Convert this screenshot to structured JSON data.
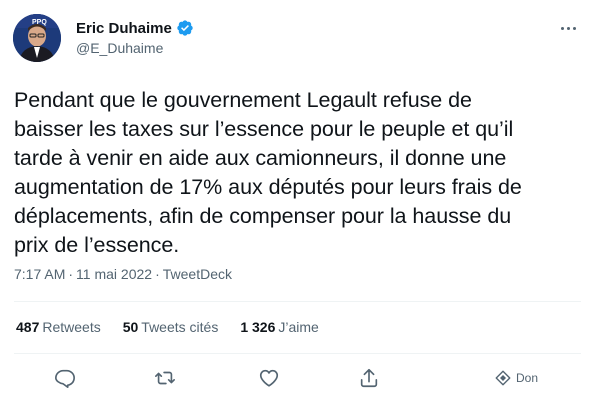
{
  "author": {
    "display_name": "Eric Duhaime",
    "handle": "@E_Duhaime",
    "verified_color": "#1d9bf0"
  },
  "tweet": {
    "text": "Pendant que le gouvernement Legault refuse de\nbaisser les taxes sur l’essence pour le peuple et qu’il\ntarde à venir en aide aux camionneurs, il donne une\naugmentation de 17% aux députés pour leurs frais de\ndéplacements, afin de compenser pour la hausse du\nprix de l’essence.",
    "time": "7:17 AM",
    "date": "11 mai 2022",
    "source": "TweetDeck",
    "separator": "·"
  },
  "stats": {
    "retweets_count": "487",
    "retweets_label": "Retweets",
    "quotes_count": "50",
    "quotes_label": "Tweets cités",
    "likes_count": "1 326",
    "likes_label": "J’aime"
  },
  "actions": {
    "tip_label": "Don",
    "icons": [
      "reply-icon",
      "retweet-icon",
      "like-icon",
      "share-icon",
      "tip-icon"
    ]
  },
  "colors": {
    "text": "#0f1419",
    "secondary": "#536471",
    "divider": "#eff3f4"
  }
}
